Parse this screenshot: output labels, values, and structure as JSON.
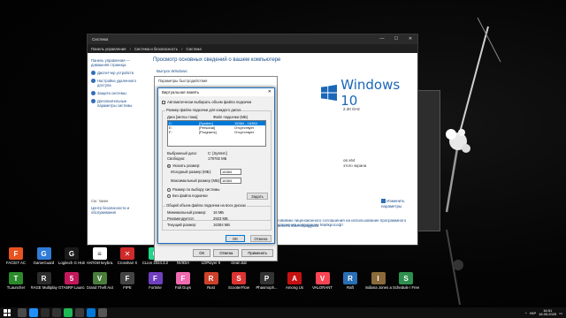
{
  "desktop_icons": [
    {
      "label": "FACEIT AC",
      "color": "#e8531f",
      "glyph": "F",
      "row": 0,
      "col": 0
    },
    {
      "label": "GameGuard",
      "color": "#2f7bd8",
      "glyph": "G",
      "row": 0,
      "col": 1
    },
    {
      "label": "Logitech G HUB",
      "color": "#1a1a1a",
      "glyph": "G",
      "row": 0,
      "col": 2
    },
    {
      "label": "НАПОИ keybra...",
      "color": "#ffffff",
      "glyph": "≡",
      "row": 0,
      "col": 3
    },
    {
      "label": "Crosshair X",
      "color": "#d02a2a",
      "glyph": "✕",
      "row": 0,
      "col": 4
    },
    {
      "label": "CLion 2024.3.2",
      "color": "#21d789",
      "glyph": "C",
      "row": 0,
      "col": 5
    },
    {
      "label": "NVIDIA",
      "color": "#76b900",
      "glyph": "N",
      "row": 0,
      "col": 6
    },
    {
      "label": "LDPlayer 9",
      "color": "#f5c400",
      "glyph": "L",
      "row": 0,
      "col": 7
    },
    {
      "label": "clean.bat",
      "color": "#3d3d3d",
      "glyph": "▤",
      "row": 0,
      "col": 8
    },
    {
      "label": "TLauncher",
      "color": "#2b8a2b",
      "glyph": "T",
      "row": 1,
      "col": 0
    },
    {
      "label": "RAGE Multiplayer",
      "color": "#2c2c2c",
      "glyph": "R",
      "row": 1,
      "col": 1
    },
    {
      "label": "GTA5RP Launcher",
      "color": "#c2185b",
      "glyph": "5",
      "row": 1,
      "col": 2
    },
    {
      "label": "Grand Theft Auto V",
      "color": "#4a7d3a",
      "glyph": "V",
      "row": 1,
      "col": 3
    },
    {
      "label": "FIPE",
      "color": "#444444",
      "glyph": "F",
      "row": 1,
      "col": 4
    },
    {
      "label": "Fortnite",
      "color": "#6f3fbf",
      "glyph": "F",
      "row": 1,
      "col": 5
    },
    {
      "label": "Fall Guys",
      "color": "#f06ab0",
      "glyph": "F",
      "row": 1,
      "col": 6
    },
    {
      "label": "Rust",
      "color": "#cd412b",
      "glyph": "R",
      "row": 1,
      "col": 7
    },
    {
      "label": "ScooterFlow",
      "color": "#d33",
      "glyph": "S",
      "row": 1,
      "col": 8
    },
    {
      "label": "Phasmoph...",
      "color": "#333333",
      "glyph": "P",
      "row": 1,
      "col": 9
    },
    {
      "label": "Among Us",
      "color": "#c51111",
      "glyph": "A",
      "row": 1,
      "col": 10
    },
    {
      "label": "VALORANT",
      "color": "#fa4454",
      "glyph": "V",
      "row": 1,
      "col": 11
    },
    {
      "label": "Raft",
      "color": "#2a6fb5",
      "glyph": "R",
      "row": 1,
      "col": 12
    },
    {
      "label": "Indiana Jones and the Gre...",
      "color": "#8a6a3a",
      "glyph": "I",
      "row": 1,
      "col": 13
    },
    {
      "label": "Schedule I Free Sample",
      "color": "#2f8f4f",
      "glyph": "S",
      "row": 1,
      "col": 14
    }
  ],
  "system_window": {
    "title": "Система",
    "address_crumbs": [
      "Панель управления",
      "Система и безопасность",
      "Система"
    ],
    "sidebar": {
      "home": "Панель управления — домашняя страница",
      "items": [
        "Диспетчер устройств",
        "Настройка удаленного доступа",
        "Защита системы",
        "Дополнительные параметры системы"
      ],
      "see_also": "См. также",
      "security": "Центр безопасности и обслуживания"
    },
    "heading": "Просмотр основных сведений о вашем компьютере",
    "edition_label": "Выпуск Windows",
    "logo_text": "Windows 10",
    "ghz": "2.30 GHz",
    "proc_suffix": "ов x64",
    "display_suffix": "этого экрана",
    "change_link": "Изменить параметры",
    "license_link": "Условиями лицензионного соглашения на использование программного обеспечения корпорации Майкрософт",
    "product_link": "Изменить ключ продукта"
  },
  "perf_dialog": {
    "title": "Параметры быстродействия",
    "ok": "OK",
    "cancel": "Отмена",
    "apply": "Применить"
  },
  "vm_dialog": {
    "title": "Виртуальная память",
    "close_glyph": "✕",
    "auto_checkbox": "Автоматически выбирать объем файла подкачки",
    "auto_checked": false,
    "group_title": "Размер файла подкачки для каждого диска",
    "col_drive": "Диск [метка тома]",
    "col_size": "Файл подкачки (МБ)",
    "drives": [
      {
        "drive": "C:",
        "label": "[System]",
        "size": "16384 - 16384",
        "selected": true
      },
      {
        "drive": "E:",
        "label": "[Personal]",
        "size": "Отсутствует",
        "selected": false
      },
      {
        "drive": "F:",
        "label": "[Programs]",
        "size": "Отсутствует",
        "selected": false
      }
    ],
    "selected_disk_label": "Выбранный диск:",
    "selected_disk_value": "C:  [System]",
    "free_label": "Свободно:",
    "free_value": "179782 МБ",
    "opt_custom": "Указать размер:",
    "initial_label": "Исходный размер (МБ):",
    "initial_value": "16384",
    "max_label": "Максимальный размер (МБ):",
    "max_value": "16384",
    "opt_system": "Размер по выбору системы",
    "opt_none": "Без файла подкачки",
    "set_button": "Задать",
    "total_title": "Общий объем файла подкачки на всех дисках",
    "min_label": "Минимальный размер:",
    "min_value": "16 МБ",
    "rec_label": "Рекомендуется:",
    "rec_value": "2923 МБ",
    "cur_label": "Текущий размер:",
    "cur_value": "16384 МБ",
    "ok": "OK",
    "cancel": "Отмена"
  },
  "taskbar": {
    "apps": [
      "#4a4a4a",
      "#1e90ff",
      "#2b2b2b",
      "#333333",
      "#1db954",
      "#3c3c3c",
      "#0078d7",
      "#555555"
    ],
    "lang": "УКР",
    "time": "16:51",
    "date": "18.05.2025"
  }
}
